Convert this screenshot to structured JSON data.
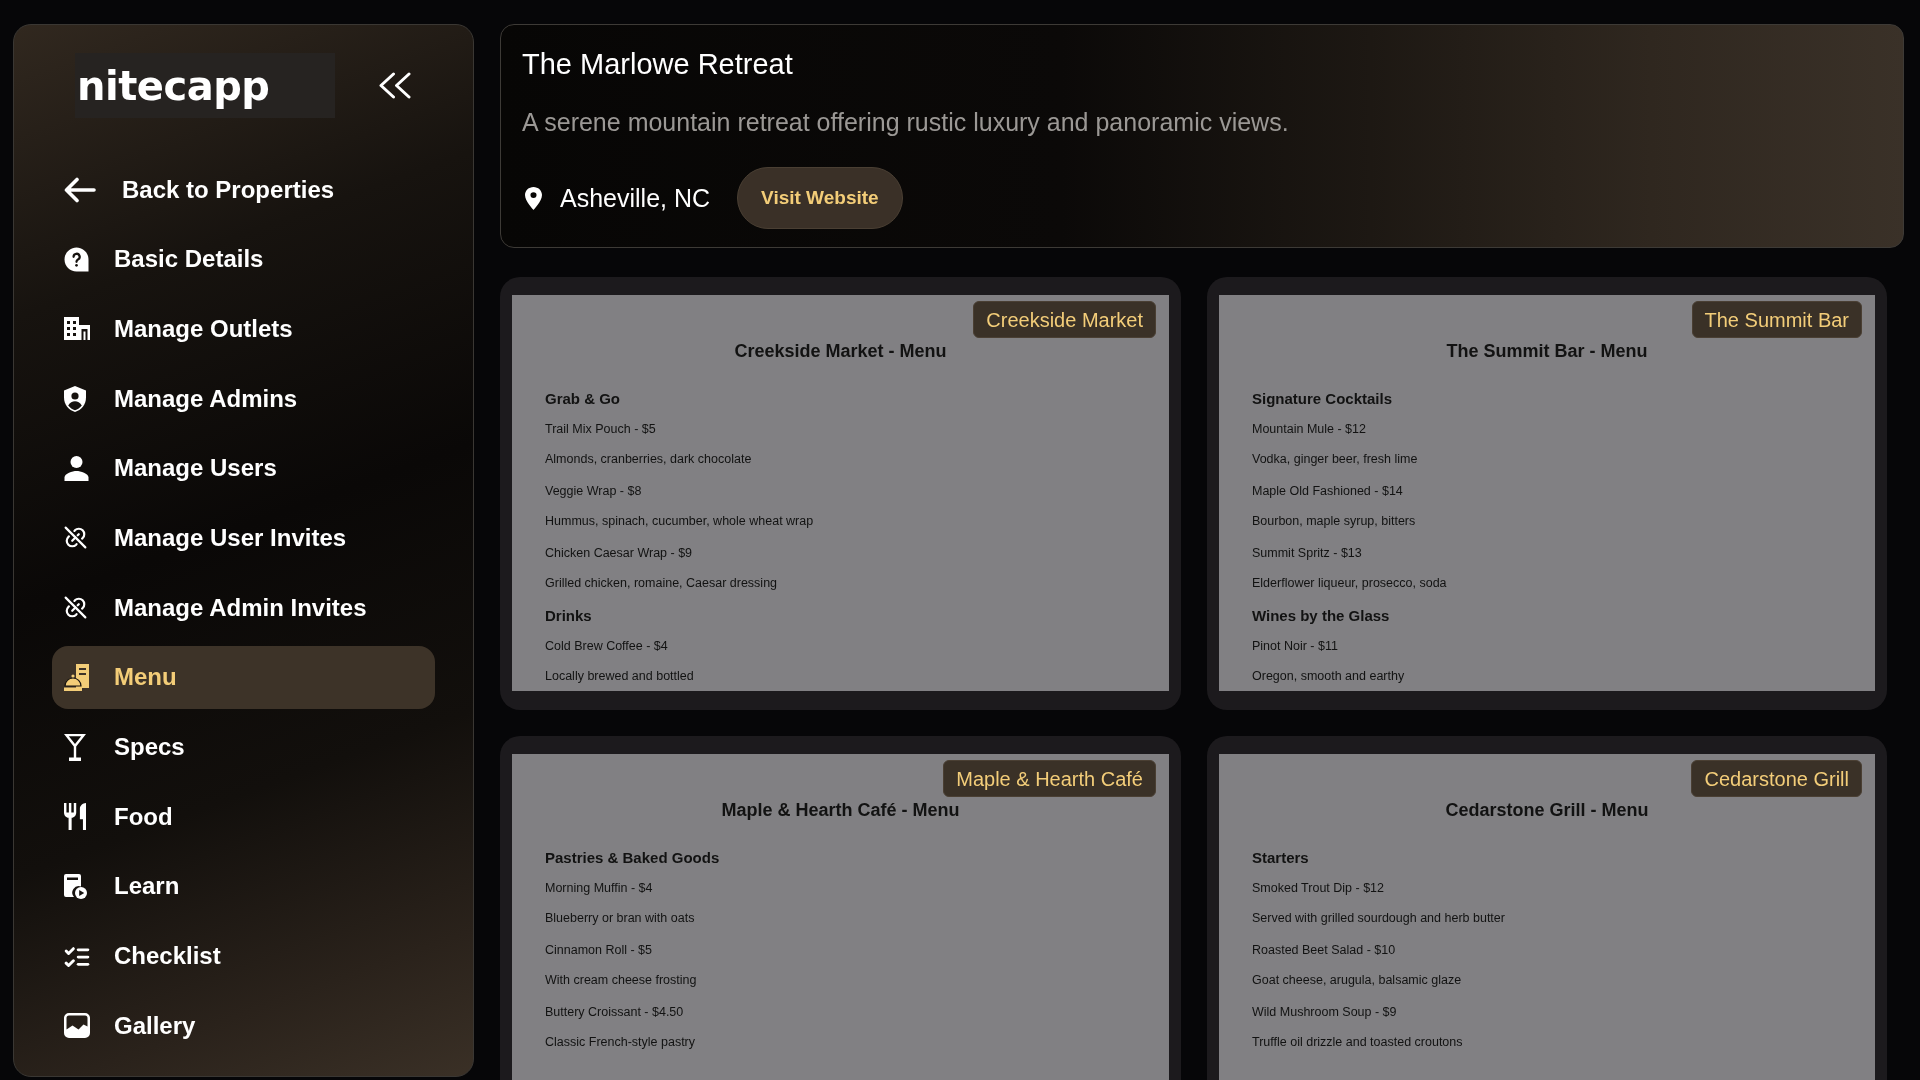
{
  "sidebar": {
    "logo": "nitecapp",
    "back_link": "Back to Properties",
    "items": [
      {
        "label": "Basic Details",
        "selected": false
      },
      {
        "label": "Manage Outlets",
        "selected": false
      },
      {
        "label": "Manage Admins",
        "selected": false
      },
      {
        "label": "Manage Users",
        "selected": false
      },
      {
        "label": "Manage User Invites",
        "selected": false
      },
      {
        "label": "Manage Admin Invites",
        "selected": false
      },
      {
        "label": "Menu",
        "selected": true
      },
      {
        "label": "Specs",
        "selected": false
      },
      {
        "label": "Food",
        "selected": false
      },
      {
        "label": "Learn",
        "selected": false
      },
      {
        "label": "Checklist",
        "selected": false
      },
      {
        "label": "Gallery",
        "selected": false
      }
    ]
  },
  "property": {
    "name": "The Marlowe Retreat",
    "description": "A serene mountain retreat offering rustic luxury and panoramic views.",
    "location": "Asheville, NC",
    "website_button": "Visit Website"
  },
  "menus": [
    {
      "badge": "Creekside Market",
      "title": "Creekside Market - Menu",
      "sections": [
        {
          "heading": "Grab & Go",
          "items": [
            {
              "name": "Trail Mix Pouch - $5",
              "description": "Almonds, cranberries, dark chocolate"
            },
            {
              "name": "Veggie Wrap - $8",
              "description": "Hummus, spinach, cucumber, whole wheat wrap"
            },
            {
              "name": "Chicken Caesar Wrap - $9",
              "description": "Grilled chicken, romaine, Caesar dressing"
            }
          ]
        },
        {
          "heading": "Drinks",
          "items": [
            {
              "name": "Cold Brew Coffee - $4",
              "description": "Locally brewed and bottled"
            }
          ]
        }
      ]
    },
    {
      "badge": "The Summit Bar",
      "title": "The Summit Bar - Menu",
      "sections": [
        {
          "heading": "Signature Cocktails",
          "items": [
            {
              "name": "Mountain Mule - $12",
              "description": "Vodka, ginger beer, fresh lime"
            },
            {
              "name": "Maple Old Fashioned - $14",
              "description": "Bourbon, maple syrup, bitters"
            },
            {
              "name": "Summit Spritz - $13",
              "description": "Elderflower liqueur, prosecco, soda"
            }
          ]
        },
        {
          "heading": "Wines by the Glass",
          "items": [
            {
              "name": "Pinot Noir - $11",
              "description": "Oregon, smooth and earthy"
            }
          ]
        }
      ]
    },
    {
      "badge": "Maple & Hearth Café",
      "title": "Maple & Hearth Café - Menu",
      "sections": [
        {
          "heading": "Pastries & Baked Goods",
          "items": [
            {
              "name": "Morning Muffin - $4",
              "description": "Blueberry or bran with oats"
            },
            {
              "name": "Cinnamon Roll - $5",
              "description": "With cream cheese frosting"
            },
            {
              "name": "Buttery Croissant - $4.50",
              "description": "Classic French-style pastry"
            }
          ]
        }
      ]
    },
    {
      "badge": "Cedarstone Grill",
      "title": "Cedarstone Grill - Menu",
      "sections": [
        {
          "heading": "Starters",
          "items": [
            {
              "name": "Smoked Trout Dip - $12",
              "description": "Served with grilled sourdough and herb butter"
            },
            {
              "name": "Roasted Beet Salad - $10",
              "description": "Goat cheese, arugula, balsamic glaze"
            },
            {
              "name": "Wild Mushroom Soup - $9",
              "description": "Truffle oil drizzle and toasted croutons"
            }
          ]
        }
      ]
    }
  ]
}
